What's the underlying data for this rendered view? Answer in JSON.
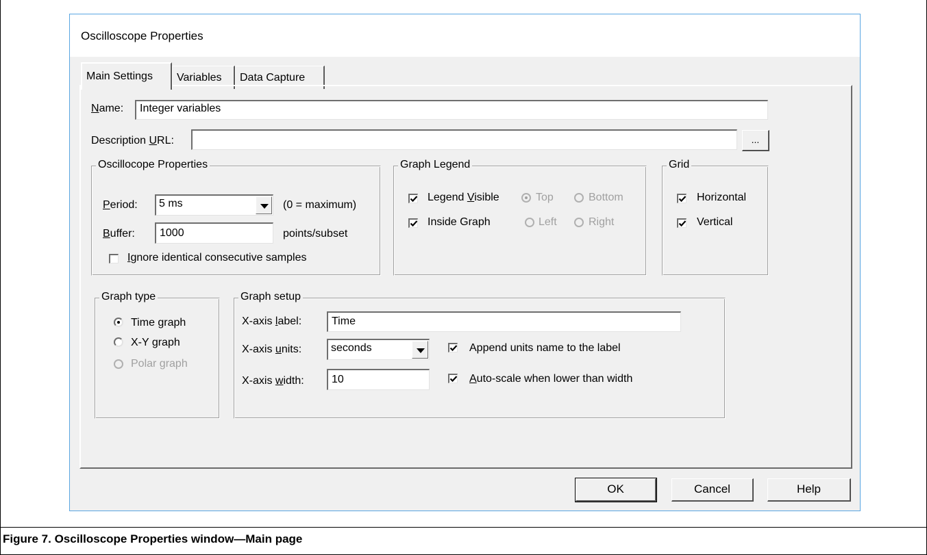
{
  "dialog": {
    "title": "Oscilloscope Properties"
  },
  "tabs": [
    {
      "label": "Main Settings",
      "active": true
    },
    {
      "label": "Variables",
      "active": false
    },
    {
      "label": "Data Capture",
      "active": false
    }
  ],
  "name": {
    "label": "Name:",
    "value": "Integer variables"
  },
  "description_url": {
    "label": "Description URL:",
    "value": "",
    "browse_label": "..."
  },
  "oscilloscope_group": {
    "title": "Oscillocope Properties",
    "period_label": "Period:",
    "period_value": "5 ms",
    "period_hint": "(0 = maximum)",
    "buffer_label": "Buffer:",
    "buffer_value": "1000",
    "buffer_unit": "points/subset",
    "ignore_label": "Ignore identical consecutive samples",
    "ignore_checked": false
  },
  "legend_group": {
    "title": "Graph Legend",
    "legend_visible_label": "Legend Visible",
    "legend_visible_checked": true,
    "inside_graph_label": "Inside Graph",
    "inside_graph_checked": true,
    "top_label": "Top",
    "bottom_label": "Bottom",
    "left_label": "Left",
    "right_label": "Right",
    "selected_position": "Top"
  },
  "grid_group": {
    "title": "Grid",
    "horizontal_label": "Horizontal",
    "horizontal_checked": true,
    "vertical_label": "Vertical",
    "vertical_checked": true
  },
  "graph_type_group": {
    "title": "Graph type",
    "time_label": "Time graph",
    "xy_label": "X-Y graph",
    "polar_label": "Polar graph",
    "selected": "Time graph"
  },
  "graph_setup_group": {
    "title": "Graph setup",
    "xlabel_label": "X-axis label:",
    "xlabel_value": "Time",
    "xunits_label": "X-axis units:",
    "xunits_value": "seconds",
    "append_label": "Append units name to the label",
    "append_checked": true,
    "xwidth_label": "X-axis width:",
    "xwidth_value": "10",
    "autoscale_label": "Auto-scale when lower than width",
    "autoscale_checked": true
  },
  "buttons": {
    "ok": "OK",
    "cancel": "Cancel",
    "help": "Help"
  },
  "caption": "Figure 7. Oscilloscope Properties window—Main page"
}
